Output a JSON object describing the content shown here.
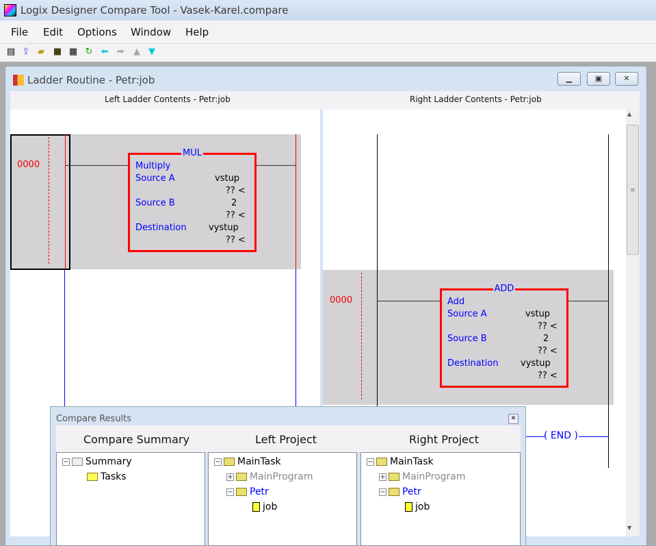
{
  "window": {
    "title": "Logix Designer Compare Tool - Vasek-Karel.compare"
  },
  "menu": [
    "File",
    "Edit",
    "Options",
    "Window",
    "Help"
  ],
  "toolbar": [
    "report-icon",
    "upload-icon",
    "open-folder-icon",
    "save-icon",
    "print-icon",
    "refresh-icon",
    "back-arrow-icon",
    "forward-arrow-icon",
    "up-triangle-icon",
    "down-triangle-icon"
  ],
  "child": {
    "title": "Ladder Routine - Petr:job",
    "left_header": "Left Ladder Contents - Petr:job",
    "right_header": "Right Ladder Contents - Petr:job"
  },
  "left_rung": {
    "number": "0000",
    "instr": "MUL",
    "name": "Multiply",
    "rows": [
      {
        "label": "Source A",
        "tag": "vstup",
        "value": "?? <"
      },
      {
        "label": "Source B",
        "tag": "2",
        "value": "?? <"
      },
      {
        "label": "Destination",
        "tag": "vystup",
        "value": "?? <"
      }
    ]
  },
  "right_rung": {
    "number": "0000",
    "instr": "ADD",
    "name": "Add",
    "rows": [
      {
        "label": "Source A",
        "tag": "vstup",
        "value": "?? <"
      },
      {
        "label": "Source B",
        "tag": "2",
        "value": "?? <"
      },
      {
        "label": "Destination",
        "tag": "vystup",
        "value": "?? <"
      }
    ],
    "end": "END"
  },
  "results": {
    "title": "Compare Results",
    "headers": [
      "Compare Summary",
      "Left Project",
      "Right Project"
    ],
    "summary": [
      "Summary",
      "Tasks"
    ],
    "left": [
      "MainTask",
      "MainProgram",
      "Petr",
      "job"
    ],
    "right": [
      "MainTask",
      "MainProgram",
      "Petr",
      "job"
    ]
  },
  "colors": {
    "diff": "#ff0000",
    "ladder": "#0000ff",
    "band": "#d4d2d4"
  }
}
